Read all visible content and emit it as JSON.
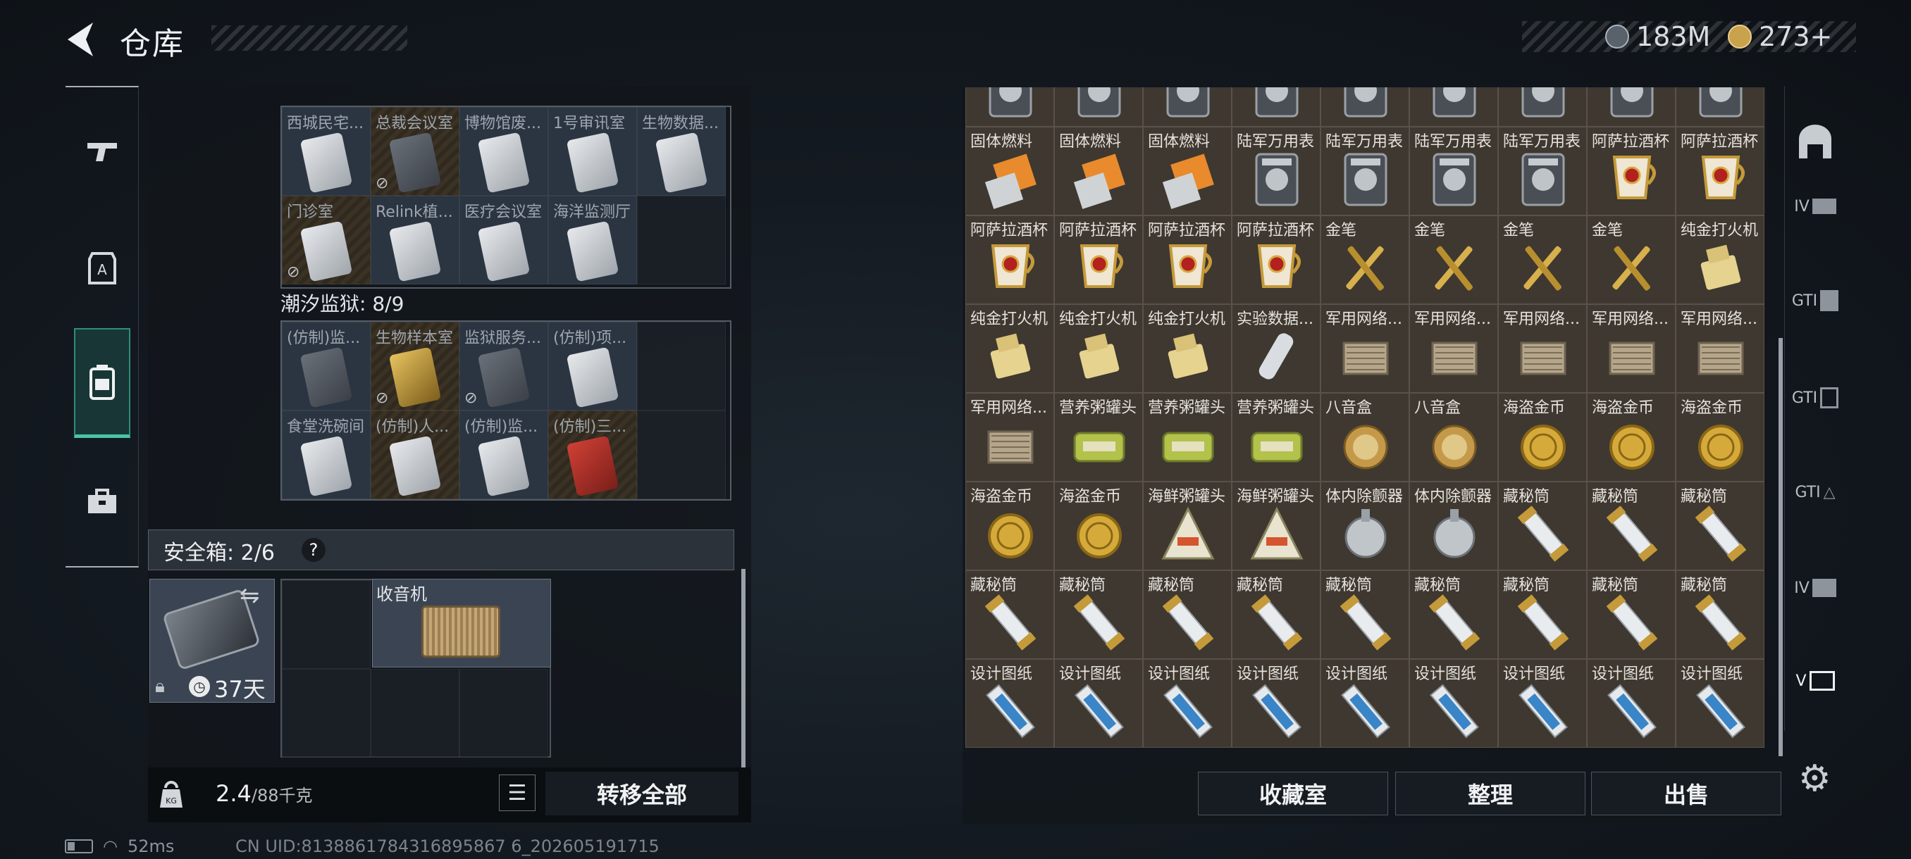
{
  "header": {
    "title": "仓库",
    "currency_silver": "183M",
    "currency_gold": "273+"
  },
  "left_nav": {
    "items": [
      {
        "name": "gun-icon",
        "glyph": "╤"
      },
      {
        "name": "armor-icon",
        "glyph": "A"
      },
      {
        "name": "backpack-icon",
        "glyph": "▤"
      },
      {
        "name": "toolbox-icon",
        "glyph": "⧇"
      }
    ]
  },
  "collection": {
    "row_a": [
      "西城民宅...",
      "总裁会议室",
      "博物馆废...",
      "1号审讯室",
      "生物数据..."
    ],
    "row_b": [
      "门诊室",
      "Relink植...",
      "医疗会议室",
      "海洋监测厅"
    ],
    "tide_label": "潮汐监狱: 8/9",
    "row_c": [
      "(仿制)监...",
      "生物样本室",
      "监狱服务...",
      "(仿制)项..."
    ],
    "row_d": [
      "食堂洗碗间",
      "(仿制)人...",
      "(仿制)监...",
      "(仿制)三..."
    ]
  },
  "safe_box": {
    "label": "安全箱: 2/6",
    "help": "?",
    "days": "37天",
    "radio_label": "收音机"
  },
  "footer_left": {
    "weight_current": "2.4",
    "weight_max": "/88千克",
    "transfer_all": "转移全部"
  },
  "status_bar": {
    "ping": "52ms",
    "uid": "CN UID:8138861784316895867 6_202605191715"
  },
  "items": {
    "rows": [
      [
        "",
        "",
        "",
        "",
        "",
        "",
        "",
        "",
        ""
      ],
      [
        "固体燃料",
        "固体燃料",
        "固体燃料",
        "陆军万用表",
        "陆军万用表",
        "陆军万用表",
        "陆军万用表",
        "阿萨拉酒杯",
        "阿萨拉酒杯"
      ],
      [
        "阿萨拉酒杯",
        "阿萨拉酒杯",
        "阿萨拉酒杯",
        "阿萨拉酒杯",
        "金笔",
        "金笔",
        "金笔",
        "金笔",
        "纯金打火机"
      ],
      [
        "纯金打火机",
        "纯金打火机",
        "纯金打火机",
        "实验数据...",
        "军用网络...",
        "军用网络...",
        "军用网络...",
        "军用网络...",
        "军用网络..."
      ],
      [
        "军用网络...",
        "营养粥罐头",
        "营养粥罐头",
        "营养粥罐头",
        "八音盒",
        "八音盒",
        "海盗金币",
        "海盗金币",
        "海盗金币"
      ],
      [
        "海盗金币",
        "海盗金币",
        "海鲜粥罐头",
        "海鲜粥罐头",
        "体内除颤器",
        "体内除颤器",
        "藏秘筒",
        "藏秘筒",
        "藏秘筒"
      ],
      [
        "藏秘筒",
        "藏秘筒",
        "藏秘筒",
        "藏秘筒",
        "藏秘筒",
        "藏秘筒",
        "藏秘筒",
        "藏秘筒",
        "藏秘筒"
      ],
      [
        "设计图纸",
        "设计图纸",
        "设计图纸",
        "设计图纸",
        "设计图纸",
        "设计图纸",
        "设计图纸",
        "设计图纸",
        "设计图纸"
      ]
    ]
  },
  "footer_right": {
    "collection_room": "收藏室",
    "organize": "整理",
    "sell": "出售"
  },
  "right_nav": {
    "items": [
      "IV",
      "GTI",
      "GTI",
      "GTI",
      "IV",
      "V"
    ]
  },
  "colors": {
    "accent_teal": "#47c7a4",
    "item_cell": "#3e3830",
    "safe_cell": "#3b4452"
  }
}
